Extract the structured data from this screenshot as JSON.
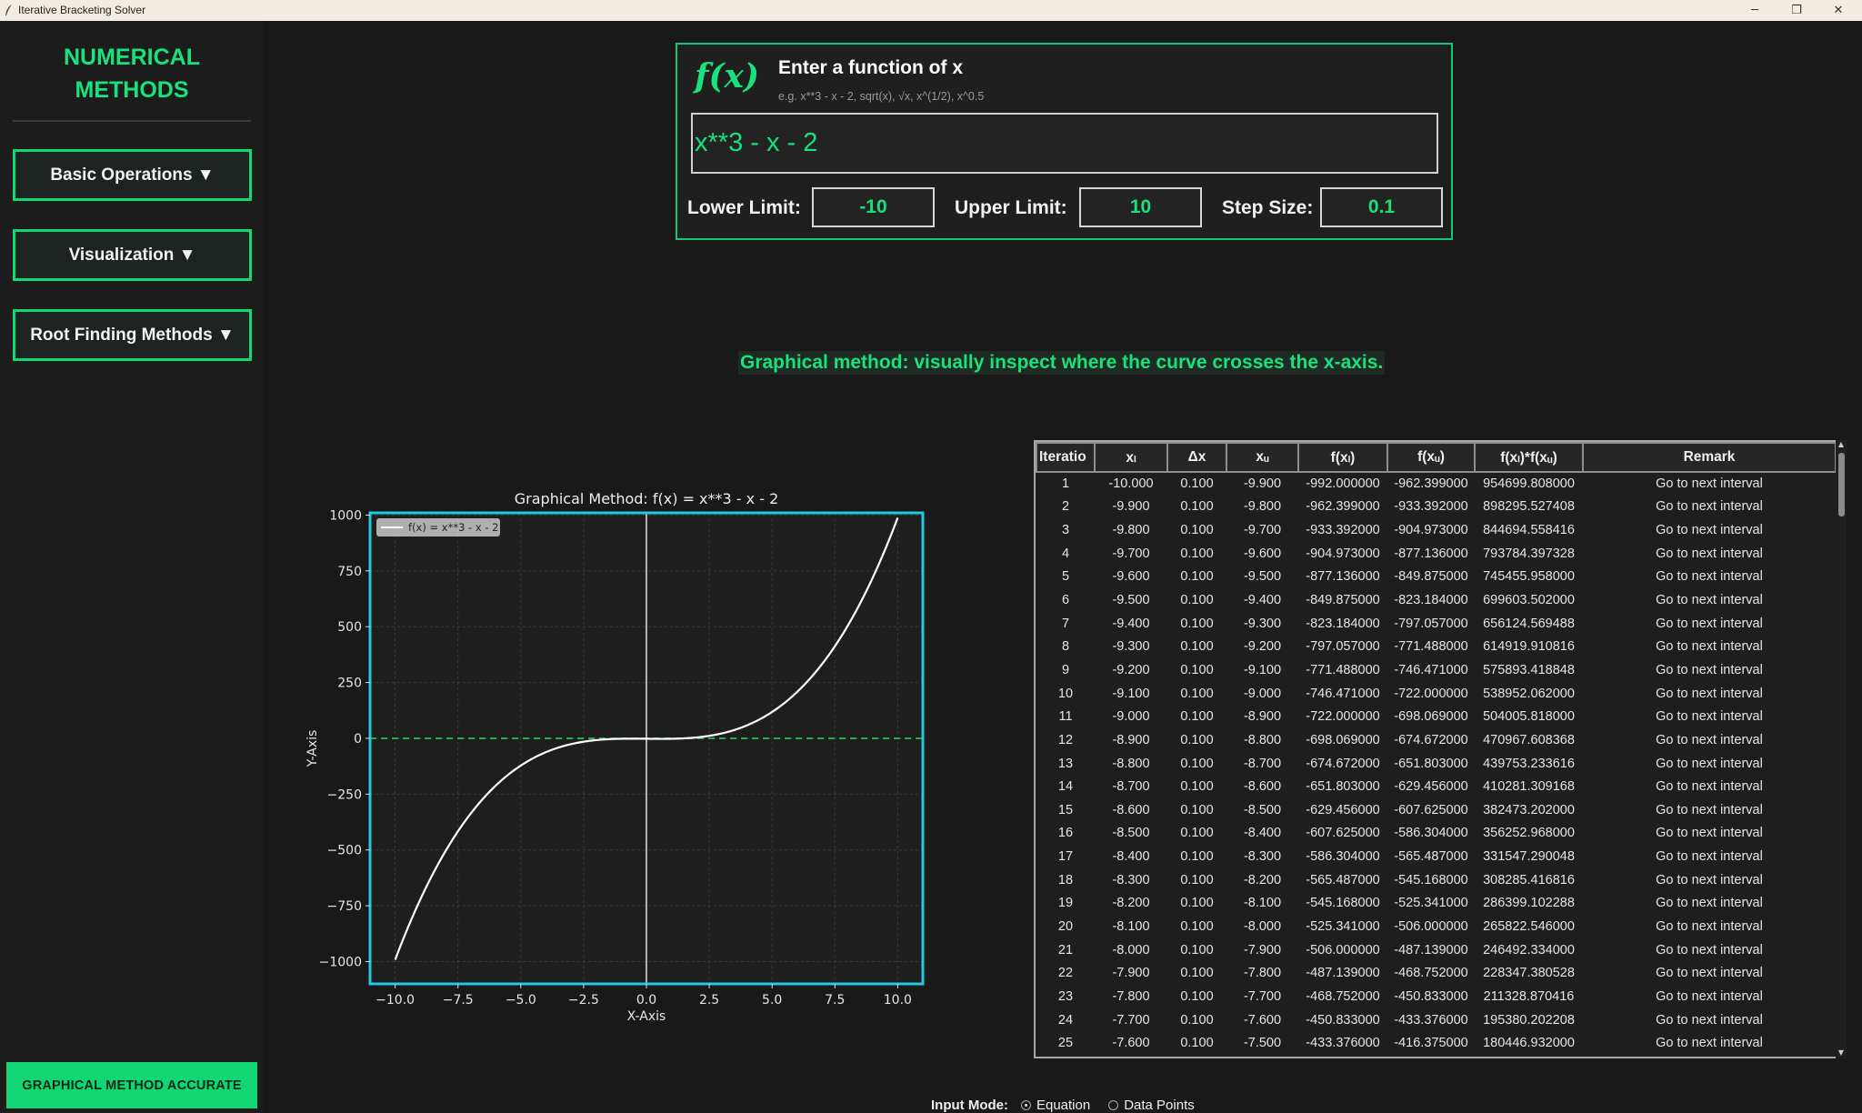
{
  "window": {
    "title": "Iterative Bracketing Solver"
  },
  "sidebar": {
    "brand_line1": "NUMERICAL",
    "brand_line2": "METHODS",
    "menu": [
      {
        "label": "Basic Operations ▼"
      },
      {
        "label": "Visualization ▼"
      },
      {
        "label": "Root Finding Methods ▼"
      }
    ],
    "status_button": "GRAPHICAL METHOD ACCURATE"
  },
  "function_panel": {
    "logo": "f(x)",
    "heading": "Enter a function of x",
    "hint": "e.g. x**3 - x - 2, sqrt(x), √x, x^(1/2), x^0.5",
    "function_value": "x**3 - x - 2",
    "lower_label": "Lower Limit:",
    "lower_value": "-10",
    "upper_label": "Upper Limit:",
    "upper_value": "10",
    "step_label": "Step Size:",
    "step_value": "0.1"
  },
  "method_note": "Graphical method: visually inspect where the curve crosses the x-axis.",
  "chart_data": {
    "type": "line",
    "title": "Graphical Method: f(x) = x**3 - x - 2",
    "xlabel": "X-Axis",
    "ylabel": "Y-Axis",
    "xlim": [
      -11,
      11
    ],
    "ylim": [
      -1100,
      1010
    ],
    "xticks": [
      -10,
      -7.5,
      -5,
      -2.5,
      0,
      2.5,
      5,
      7.5,
      10
    ],
    "xtick_labels": [
      "−10.0",
      "−7.5",
      "−5.0",
      "−2.5",
      "0.0",
      "2.5",
      "5.0",
      "7.5",
      "10.0"
    ],
    "yticks": [
      -1000,
      -750,
      -500,
      -250,
      0,
      250,
      500,
      750,
      1000
    ],
    "ytick_labels": [
      "−1000",
      "−750",
      "−500",
      "−250",
      "0",
      "250",
      "500",
      "750",
      "1000"
    ],
    "grid": true,
    "legend_position": "top-left",
    "series": [
      {
        "name": "f(x) = x**3 - x - 2",
        "expression": "x**3 - x - 2",
        "x_range": [
          -10,
          10
        ],
        "color": "#ffffff"
      }
    ],
    "reference_lines": [
      {
        "kind": "horizontal",
        "y": 0,
        "style": "dashed",
        "color": "#1fb23c"
      },
      {
        "kind": "vertical",
        "x": 0,
        "style": "solid",
        "color": "#e0e0e0"
      }
    ],
    "colors": {
      "background": "#1e1e1e",
      "frame": "#22c9df",
      "grid": "#3a3a3a"
    }
  },
  "table": {
    "columns": [
      "Iteratio",
      "xₗ",
      "Δx",
      "xᵤ",
      "f(xₗ)",
      "f(xᵤ)",
      "f(xₗ)*f(xᵤ)",
      "Remark"
    ],
    "rows": [
      [
        "1",
        "-10.000",
        "0.100",
        "-9.900",
        "-992.000000",
        "-962.399000",
        "954699.808000",
        "Go to next interval"
      ],
      [
        "2",
        "-9.900",
        "0.100",
        "-9.800",
        "-962.399000",
        "-933.392000",
        "898295.527408",
        "Go to next interval"
      ],
      [
        "3",
        "-9.800",
        "0.100",
        "-9.700",
        "-933.392000",
        "-904.973000",
        "844694.558416",
        "Go to next interval"
      ],
      [
        "4",
        "-9.700",
        "0.100",
        "-9.600",
        "-904.973000",
        "-877.136000",
        "793784.397328",
        "Go to next interval"
      ],
      [
        "5",
        "-9.600",
        "0.100",
        "-9.500",
        "-877.136000",
        "-849.875000",
        "745455.958000",
        "Go to next interval"
      ],
      [
        "6",
        "-9.500",
        "0.100",
        "-9.400",
        "-849.875000",
        "-823.184000",
        "699603.502000",
        "Go to next interval"
      ],
      [
        "7",
        "-9.400",
        "0.100",
        "-9.300",
        "-823.184000",
        "-797.057000",
        "656124.569488",
        "Go to next interval"
      ],
      [
        "8",
        "-9.300",
        "0.100",
        "-9.200",
        "-797.057000",
        "-771.488000",
        "614919.910816",
        "Go to next interval"
      ],
      [
        "9",
        "-9.200",
        "0.100",
        "-9.100",
        "-771.488000",
        "-746.471000",
        "575893.418848",
        "Go to next interval"
      ],
      [
        "10",
        "-9.100",
        "0.100",
        "-9.000",
        "-746.471000",
        "-722.000000",
        "538952.062000",
        "Go to next interval"
      ],
      [
        "11",
        "-9.000",
        "0.100",
        "-8.900",
        "-722.000000",
        "-698.069000",
        "504005.818000",
        "Go to next interval"
      ],
      [
        "12",
        "-8.900",
        "0.100",
        "-8.800",
        "-698.069000",
        "-674.672000",
        "470967.608368",
        "Go to next interval"
      ],
      [
        "13",
        "-8.800",
        "0.100",
        "-8.700",
        "-674.672000",
        "-651.803000",
        "439753.233616",
        "Go to next interval"
      ],
      [
        "14",
        "-8.700",
        "0.100",
        "-8.600",
        "-651.803000",
        "-629.456000",
        "410281.309168",
        "Go to next interval"
      ],
      [
        "15",
        "-8.600",
        "0.100",
        "-8.500",
        "-629.456000",
        "-607.625000",
        "382473.202000",
        "Go to next interval"
      ],
      [
        "16",
        "-8.500",
        "0.100",
        "-8.400",
        "-607.625000",
        "-586.304000",
        "356252.968000",
        "Go to next interval"
      ],
      [
        "17",
        "-8.400",
        "0.100",
        "-8.300",
        "-586.304000",
        "-565.487000",
        "331547.290048",
        "Go to next interval"
      ],
      [
        "18",
        "-8.300",
        "0.100",
        "-8.200",
        "-565.487000",
        "-545.168000",
        "308285.416816",
        "Go to next interval"
      ],
      [
        "19",
        "-8.200",
        "0.100",
        "-8.100",
        "-545.168000",
        "-525.341000",
        "286399.102288",
        "Go to next interval"
      ],
      [
        "20",
        "-8.100",
        "0.100",
        "-8.000",
        "-525.341000",
        "-506.000000",
        "265822.546000",
        "Go to next interval"
      ],
      [
        "21",
        "-8.000",
        "0.100",
        "-7.900",
        "-506.000000",
        "-487.139000",
        "246492.334000",
        "Go to next interval"
      ],
      [
        "22",
        "-7.900",
        "0.100",
        "-7.800",
        "-487.139000",
        "-468.752000",
        "228347.380528",
        "Go to next interval"
      ],
      [
        "23",
        "-7.800",
        "0.100",
        "-7.700",
        "-468.752000",
        "-450.833000",
        "211328.870416",
        "Go to next interval"
      ],
      [
        "24",
        "-7.700",
        "0.100",
        "-7.600",
        "-450.833000",
        "-433.376000",
        "195380.202208",
        "Go to next interval"
      ],
      [
        "25",
        "-7.600",
        "0.100",
        "-7.500",
        "-433.376000",
        "-416.375000",
        "180446.932000",
        "Go to next interval"
      ]
    ]
  },
  "input_mode": {
    "label": "Input Mode:",
    "options": [
      "Equation",
      "Data Points"
    ],
    "selected": "Equation"
  },
  "icons": {
    "app": "feather-icon",
    "minimize": "minimize-icon",
    "maximize": "restore-icon",
    "close": "close-icon"
  },
  "colors": {
    "accent": "#19e27c",
    "background": "#191919",
    "chart_frame": "#22c9df"
  }
}
